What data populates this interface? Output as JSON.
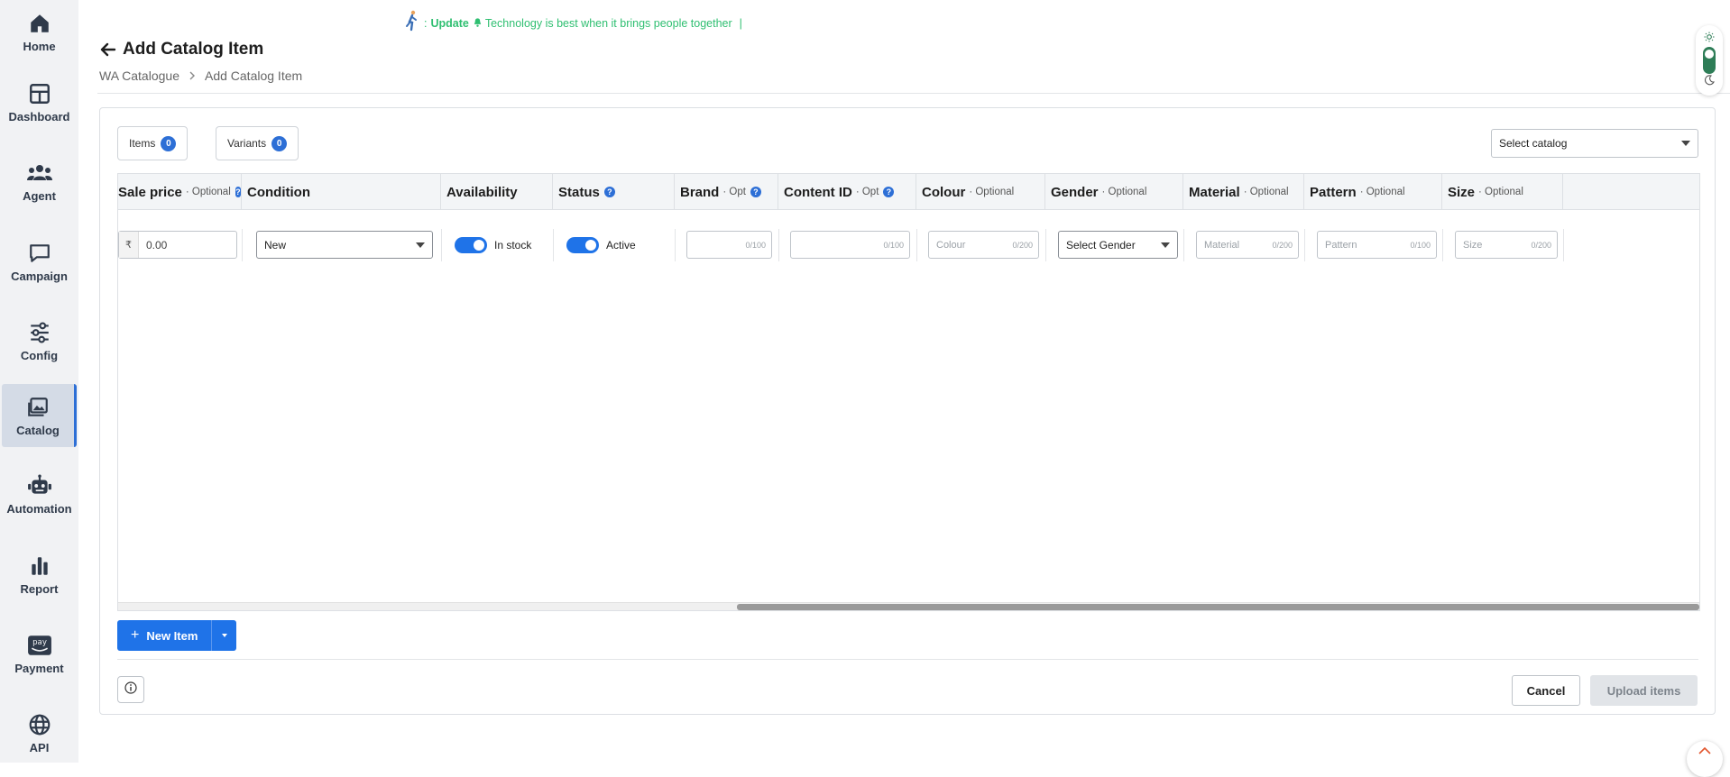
{
  "sidebar": {
    "items": [
      {
        "label": "Home",
        "icon": "home-icon"
      },
      {
        "label": "Dashboard",
        "icon": "dashboard-icon"
      },
      {
        "label": "Agent",
        "icon": "agent-icon"
      },
      {
        "label": "Campaign",
        "icon": "campaign-icon"
      },
      {
        "label": "Config",
        "icon": "config-icon"
      },
      {
        "label": "Catalog",
        "icon": "catalog-icon",
        "active": true
      },
      {
        "label": "Automation",
        "icon": "automation-icon"
      },
      {
        "label": "Report",
        "icon": "report-icon"
      },
      {
        "label": "Payment",
        "icon": "payment-icon"
      },
      {
        "label": "API",
        "icon": "api-icon"
      }
    ]
  },
  "announcement": {
    "prefix": ":",
    "keyword": "Update",
    "message": "Technology is best when it brings people together",
    "cursor": "|"
  },
  "header": {
    "title": "Add Catalog Item",
    "breadcrumb": [
      "WA Catalogue",
      "Add Catalog Item"
    ]
  },
  "toolbar": {
    "items_label": "Items",
    "items_count": "0",
    "variants_label": "Variants",
    "variants_count": "0",
    "select_catalog": "Select catalog"
  },
  "table": {
    "columns": [
      {
        "title": "Sale price",
        "suffix": "· Optional",
        "help": true
      },
      {
        "title": "Condition",
        "suffix": "",
        "help": false
      },
      {
        "title": "Availability",
        "suffix": "",
        "help": false
      },
      {
        "title": "Status",
        "suffix": "",
        "help": true
      },
      {
        "title": "Brand",
        "suffix": "· Opt",
        "help": true
      },
      {
        "title": "Content ID",
        "suffix": "· Opt",
        "help": true
      },
      {
        "title": "Colour",
        "suffix": "· Optional",
        "help": false
      },
      {
        "title": "Gender",
        "suffix": "· Optional",
        "help": false
      },
      {
        "title": "Material",
        "suffix": "· Optional",
        "help": false
      },
      {
        "title": "Pattern",
        "suffix": "· Optional",
        "help": false
      },
      {
        "title": "Size",
        "suffix": "· Optional",
        "help": false
      }
    ],
    "row": {
      "currency": "₹",
      "sale_price": "0.00",
      "condition": "New",
      "availability": "In stock",
      "status": "Active",
      "brand_count": "0/100",
      "content_id_count": "0/100",
      "colour_placeholder": "Colour",
      "colour_count": "0/200",
      "gender": "Select Gender",
      "material_placeholder": "Material",
      "material_count": "0/200",
      "pattern_placeholder": "Pattern",
      "pattern_count": "0/100",
      "size_placeholder": "Size",
      "size_count": "0/200"
    }
  },
  "actions": {
    "new_item": "New Item",
    "cancel": "Cancel",
    "upload": "Upload items"
  },
  "colors": {
    "primary": "#1f73e8",
    "announce": "#2fbf71",
    "sidebar_bg": "#f1f2f4"
  }
}
